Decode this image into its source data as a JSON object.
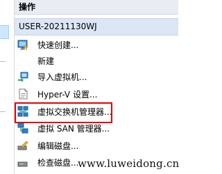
{
  "header": {
    "title": "操作"
  },
  "server": {
    "name": "USER-20211130WJ"
  },
  "actions": [
    {
      "label": "快速创建...",
      "icon": "quick-create-icon"
    },
    {
      "label": "新建",
      "icon": "new-icon"
    },
    {
      "label": "导入虚拟机...",
      "icon": "import-vm-icon"
    },
    {
      "label": "Hyper-V 设置...",
      "icon": "settings-icon"
    },
    {
      "label": "虚拟交换机管理器...",
      "icon": "virtual-switch-icon"
    },
    {
      "label": "虚拟 SAN 管理器...",
      "icon": "virtual-san-icon"
    },
    {
      "label": "编辑磁盘...",
      "icon": "edit-disk-icon"
    },
    {
      "label": "检查磁盘...",
      "icon": "inspect-disk-icon"
    }
  ],
  "watermark": {
    "text": "www.luweidong.cn"
  },
  "colors": {
    "highlight": "#e60000",
    "header_bg": "#e9ecf2",
    "selected_row": "#dce6f4"
  }
}
